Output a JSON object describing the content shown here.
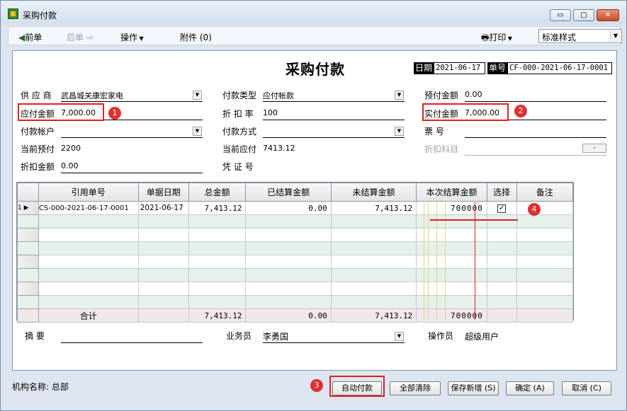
{
  "window": {
    "title": "采购付款",
    "minimize": "▭",
    "maximize": "▢",
    "close": "✕"
  },
  "toolbar": {
    "prev": "前单",
    "next": "后单",
    "actions": "操作",
    "attach": "附件 (0)",
    "print": "打印",
    "style_value": "标准样式"
  },
  "doc": {
    "title": "采购付款",
    "date_label": "日期",
    "date_value": "2021-06-17",
    "no_label": "单号",
    "no_value": "CF-000-2021-06-17-0001"
  },
  "fields": {
    "supplier_label": "供 应 商",
    "supplier_value": "武昌城关康宏家电",
    "payable_label": "应付金额",
    "payable_value": "7,000.00",
    "account_label": "付款帐户",
    "account_value": "",
    "cur_prepay_label": "当前预付",
    "cur_prepay_value": "2200",
    "discount_amt_label": "折扣金额",
    "discount_amt_value": "0.00",
    "paytype_label": "付款类型",
    "paytype_value": "应付帐款",
    "rate_label": "折 扣 率",
    "rate_value": "100",
    "method_label": "付款方式",
    "method_value": "",
    "cur_payable_label": "当前应付",
    "cur_payable_value": "7413.12",
    "voucher_label": "凭 证 号",
    "voucher_value": "",
    "prepaid_label": "预付金额",
    "prepaid_value": "0.00",
    "actual_label": "实付金额",
    "actual_value": "7,000.00",
    "ticket_label": "票    号",
    "ticket_value": "",
    "discount_subj_label": "折扣科目",
    "discount_subj_value": ""
  },
  "grid": {
    "columns": [
      "引用单号",
      "单据日期",
      "总金额",
      "已结算金额",
      "未结算金额",
      "本次结算金额",
      "选择",
      "备注"
    ],
    "rows": [
      {
        "idx": "1",
        "ref": "CS-000-2021-06-17-0001",
        "date": "2021-06-17",
        "total": "7,413.12",
        "settled": "0.00",
        "unsettled": "7,413.12",
        "this": "700000",
        "checked": "✓",
        "note": ""
      }
    ],
    "total_row": {
      "label": "合计",
      "total": "7,413.12",
      "settled": "0.00",
      "unsettled": "7,413.12",
      "this": "700000"
    }
  },
  "bottom": {
    "summary_label": "摘    要",
    "summary_value": "",
    "staff_label": "业务员",
    "staff_value": "李勇国",
    "operator_label": "操作员",
    "operator_value": "超级用户"
  },
  "status": {
    "org": "机构名称: 总部"
  },
  "buttons": {
    "auto_pay": "自动付款",
    "clear_all": "全部清除",
    "save_new": "保存新增 (S)",
    "ok": "确定 (A)",
    "cancel": "取消 (C)"
  },
  "badges": [
    "1",
    "2",
    "3",
    "4"
  ],
  "colors": {
    "highlight": "#e02020",
    "titlebar": "#d3dfec",
    "grid_alt": "#e5f1ea",
    "total_row": "#f1e6ea"
  }
}
